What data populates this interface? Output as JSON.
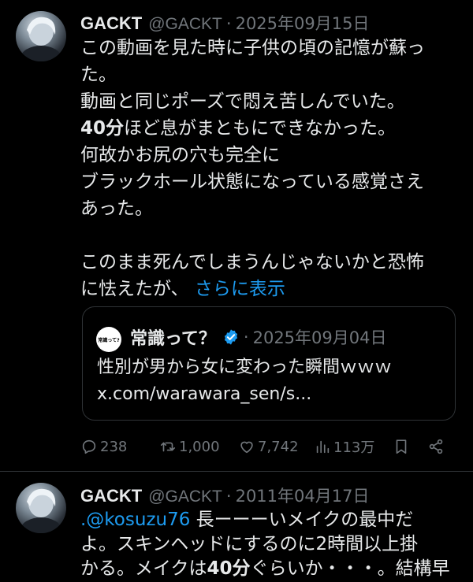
{
  "tweet1": {
    "name": "GACKT",
    "handle": "@GACKT",
    "separator": "·",
    "date": "2025年09月15日",
    "lines": [
      "この動画を見た時に子供の頃の記憶が蘇っ",
      "た。",
      "動画と同じポーズで悶え苦しんでいた。",
      "",
      "何故かお尻の穴も完全に",
      "ブラックホール状態になっている感覚さえ",
      "あった。",
      "",
      "このまま死んでしまうんじゃないかと恐怖",
      "に怯えたが、"
    ],
    "bold_part": "40分",
    "line4_rest": "ほど息がまともにできなかった。",
    "show_more": "さらに表示",
    "quote": {
      "avatar_text": "常識って?",
      "name": "常識って？",
      "separator": "·",
      "date": "2025年09月04日",
      "line1": "性別が男から女に変わった瞬間ｗｗｗ",
      "line2": "x.com/warawara_sen/s..."
    },
    "actions": {
      "replies": "238",
      "retweets": "1,000",
      "likes": "7,742",
      "views": "113万"
    }
  },
  "tweet2": {
    "name": "GACKT",
    "handle": "@GACKT",
    "separator": "·",
    "date": "2011年04月17日",
    "mention": ".@kosuzu76",
    "line1_rest": " 長ーーーいメイクの最中だ",
    "line2": "よ。スキンヘッドにするのに2時間以上掛",
    "line3_a": "かる。メイクは",
    "line3_bold": "40分",
    "line3_b": "ぐらいか・・・。結構早"
  },
  "colors": {
    "background": "#000000",
    "text": "#e7e9ea",
    "muted": "#71767b",
    "accent": "#1d9bf0"
  }
}
